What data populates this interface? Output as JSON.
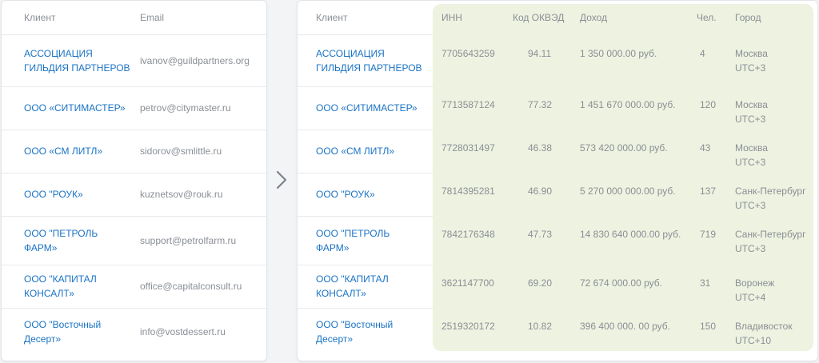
{
  "left_table": {
    "headers": {
      "client": "Клиент",
      "email": "Email"
    },
    "rows": [
      {
        "client": "АССОЦИАЦИЯ\nГИЛЬДИЯ ПАРТНЕРОВ",
        "email": "ivanov@guildpartners.org"
      },
      {
        "client": "ООО «СИТИМАСТЕР»",
        "email": "petrov@citymaster.ru"
      },
      {
        "client": "ООО «СМ ЛИТЛ»",
        "email": "sidorov@smlittle.ru"
      },
      {
        "client": "ООО \"РОУК»",
        "email": "kuznetsov@rouk.ru"
      },
      {
        "client": "ООО \"ПЕТРОЛЬ\nФАРМ»",
        "email": "support@petrolfarm.ru"
      },
      {
        "client": "ООО \"КАПИТАЛ\nКОНСАЛТ»",
        "email": "office@capitalconsult.ru"
      },
      {
        "client": "ООО \"Восточный\nДесерт»",
        "email": "info@vostdessert.ru"
      }
    ]
  },
  "right_table": {
    "headers": {
      "client": "Клиент",
      "inn": "ИНН",
      "okved": "Код ОКВЭД",
      "income": "Доход",
      "people": "Чел.",
      "city": "Город"
    },
    "rows": [
      {
        "client": "АССОЦИАЦИЯ\nГИЛЬДИЯ ПАРТНЕРОВ",
        "inn": "7705643259",
        "okved": "94.11",
        "income": "1 350 000.00 руб.",
        "people": "4",
        "city": "Москва\nUTC+3"
      },
      {
        "client": "ООО «СИТИМАСТЕР»",
        "inn": "7713587124",
        "okved": "77.32",
        "income": "1 451 670 000.00 руб.",
        "people": "120",
        "city": "Москва\nUTC+3"
      },
      {
        "client": "ООО «СМ ЛИТЛ»",
        "inn": "7728031497",
        "okved": "46.38",
        "income": "573 420 000.00 руб.",
        "people": "43",
        "city": "Москва\nUTC+3"
      },
      {
        "client": "ООО \"РОУК»",
        "inn": "7814395281",
        "okved": "46.90",
        "income": "5 270 000 000.00 руб.",
        "people": "137",
        "city": "Санк-Петербург\nUTC+3"
      },
      {
        "client": "ООО \"ПЕТРОЛЬ\nФАРМ»",
        "inn": "7842176348",
        "okved": "47.73",
        "income": "14 830 640 000.00 руб.",
        "people": "719",
        "city": "Санк-Петербург\nUTC+3"
      },
      {
        "client": "ООО \"КАПИТАЛ\nКОНСАЛТ»",
        "inn": "3621147700",
        "okved": "69.20",
        "income": "72 674 000.00 руб.",
        "people": "31",
        "city": "Воронеж\nUTC+4"
      },
      {
        "client": "ООО \"Восточный\nДесерт»",
        "inn": "2519320172",
        "okved": "10.82",
        "income": "396 400 000. 00 руб.",
        "people": "150",
        "city": "Владивосток\nUTC+10"
      }
    ]
  },
  "colors": {
    "link": "#1a73c4",
    "muted_text": "#8a8f96",
    "highlight": "#eef2e0"
  },
  "icons": {
    "transition": "chevron-right-icon"
  }
}
